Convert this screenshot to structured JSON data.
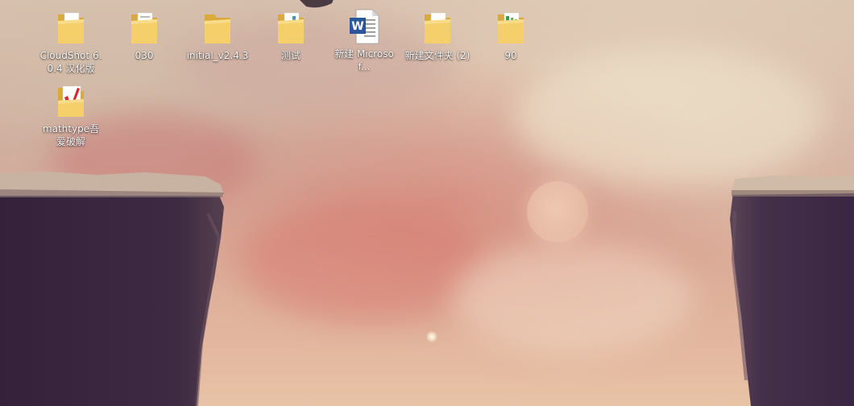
{
  "desktop": {
    "icons": [
      {
        "label": "CloudShot 6.0.4 汉化版",
        "icon": "folder-icon"
      },
      {
        "label": "030",
        "icon": "folder-icon"
      },
      {
        "label": "initial_v2.4.3",
        "icon": "folder-icon"
      },
      {
        "label": "测试",
        "icon": "folder-icon"
      },
      {
        "label": "新建 Microsof...",
        "icon": "word-document-icon"
      },
      {
        "label": "新建文件夹 (2)",
        "icon": "folder-icon"
      },
      {
        "label": "90",
        "icon": "folder-icon"
      },
      {
        "label": "mathtype吾爱破解",
        "icon": "mathtype-icon"
      }
    ]
  },
  "colors": {
    "folder_yellow": "#f4cf6a",
    "folder_dark": "#d9a93a",
    "word_blue": "#2b579a",
    "cliff_dark": "#3a2640",
    "cliff_top": "#c9b3a3",
    "label_text": "#ffffff"
  }
}
